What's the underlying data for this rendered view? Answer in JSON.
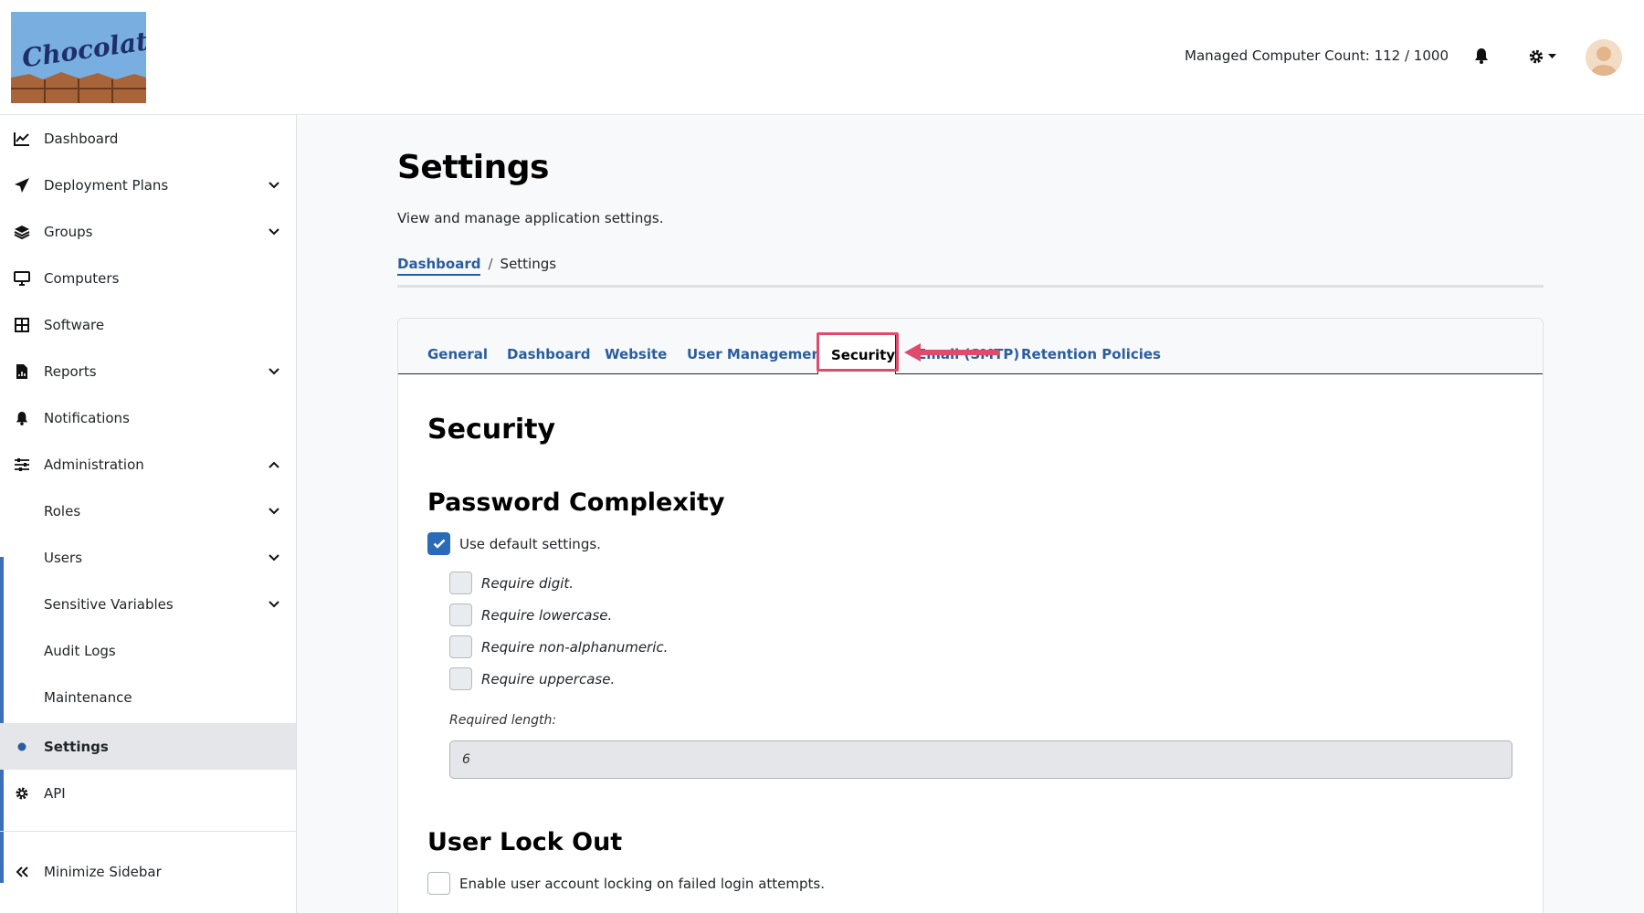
{
  "header": {
    "logo_text": "Chocolatey",
    "managed_count": "Managed Computer Count: 112 / 1000"
  },
  "sidebar": {
    "items": [
      {
        "label": "Dashboard"
      },
      {
        "label": "Deployment Plans"
      },
      {
        "label": "Groups"
      },
      {
        "label": "Computers"
      },
      {
        "label": "Software"
      },
      {
        "label": "Reports"
      },
      {
        "label": "Notifications"
      },
      {
        "label": "Administration"
      },
      {
        "label": "Roles"
      },
      {
        "label": "Users"
      },
      {
        "label": "Sensitive Variables"
      },
      {
        "label": "Audit Logs"
      },
      {
        "label": "Maintenance"
      },
      {
        "label": "Settings"
      },
      {
        "label": "API"
      }
    ],
    "minimize_label": "Minimize Sidebar"
  },
  "page": {
    "title": "Settings",
    "subtitle": "View and manage application settings.",
    "breadcrumb": {
      "link": "Dashboard",
      "separator": "/",
      "current": "Settings"
    }
  },
  "tabs": [
    {
      "label": "General"
    },
    {
      "label": "Dashboard"
    },
    {
      "label": "Website"
    },
    {
      "label": "User Management"
    },
    {
      "label": "Security"
    },
    {
      "label": "Email (SMTP)"
    },
    {
      "label": "Retention Policies"
    }
  ],
  "security": {
    "title": "Security",
    "password": {
      "heading": "Password Complexity",
      "use_default": "Use default settings.",
      "use_default_checked": true,
      "options": [
        {
          "label": "Require digit.",
          "checked": false
        },
        {
          "label": "Require lowercase.",
          "checked": false
        },
        {
          "label": "Require non-alphanumeric.",
          "checked": false
        },
        {
          "label": "Require uppercase.",
          "checked": false
        }
      ],
      "required_length_label": "Required length:",
      "required_length_value": "6"
    },
    "lockout": {
      "heading": "User Lock Out",
      "enable_label": "Enable user account locking on failed login attempts.",
      "enable_checked": false
    }
  },
  "colors": {
    "accent": "#2a5d9f",
    "checkbox_checked": "#2a6bb7",
    "highlight": "#e04b6b",
    "active_nav_bg": "#e4e6ea"
  }
}
